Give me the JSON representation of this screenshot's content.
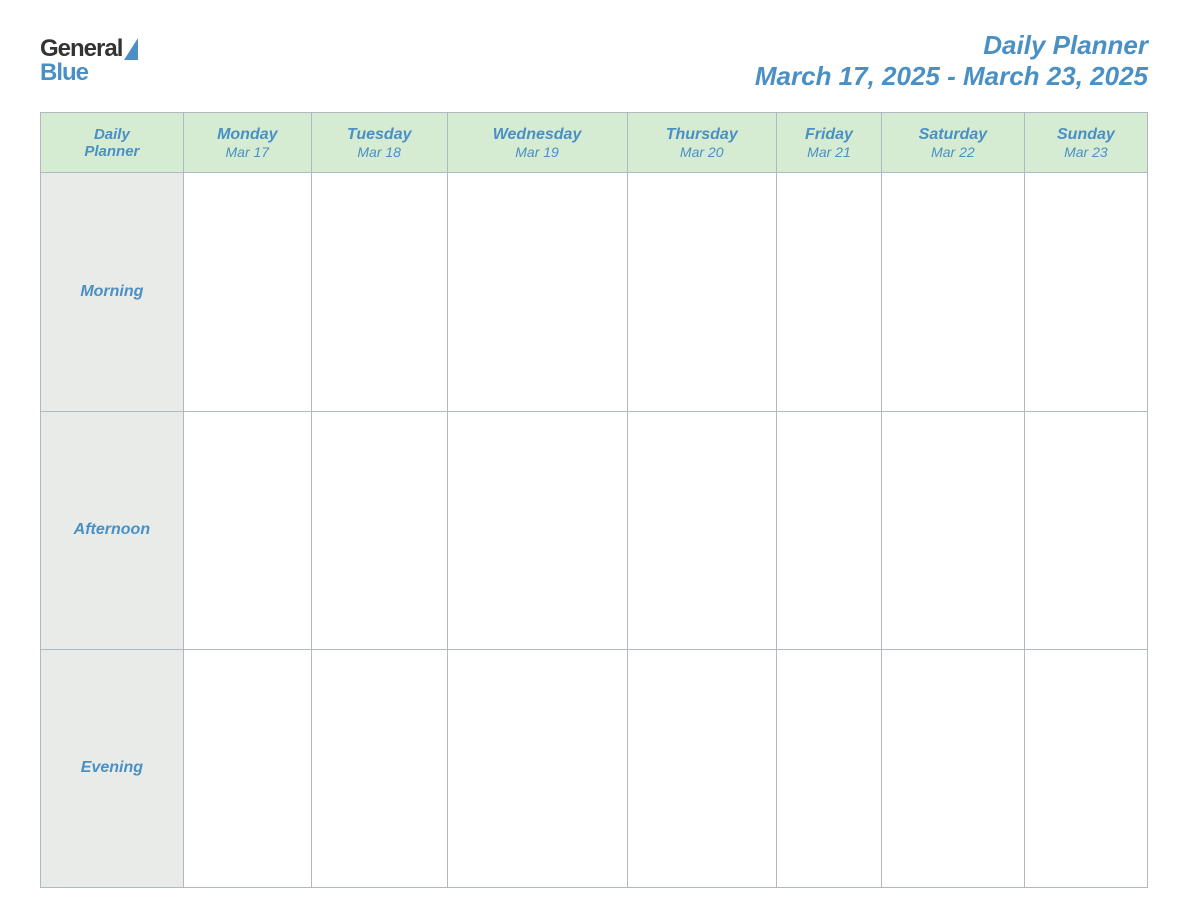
{
  "header": {
    "logo": {
      "general": "General",
      "blue": "Blue"
    },
    "title": "Daily Planner",
    "date_range": "March 17, 2025 - March 23, 2025"
  },
  "table": {
    "header_label_line1": "Daily",
    "header_label_line2": "Planner",
    "days": [
      {
        "name": "Monday",
        "date": "Mar 17"
      },
      {
        "name": "Tuesday",
        "date": "Mar 18"
      },
      {
        "name": "Wednesday",
        "date": "Mar 19"
      },
      {
        "name": "Thursday",
        "date": "Mar 20"
      },
      {
        "name": "Friday",
        "date": "Mar 21"
      },
      {
        "name": "Saturday",
        "date": "Mar 22"
      },
      {
        "name": "Sunday",
        "date": "Mar 23"
      }
    ],
    "rows": [
      {
        "label": "Morning"
      },
      {
        "label": "Afternoon"
      },
      {
        "label": "Evening"
      }
    ]
  }
}
